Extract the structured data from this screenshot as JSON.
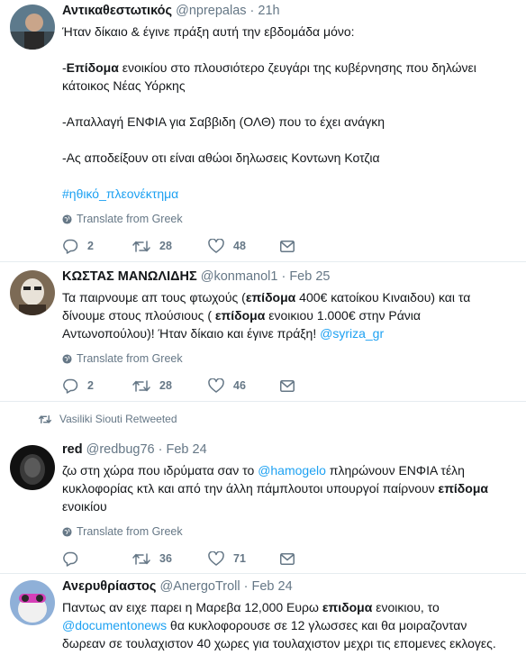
{
  "tweets": [
    {
      "name": "Αντικαθεστωτικός",
      "handle": "@nprepalas",
      "time": "21h",
      "lines": [
        [
          {
            "t": "Ήταν δίκαιο & έγινε πράξη αυτή την εβδομάδα μόνο:"
          }
        ],
        [],
        [
          {
            "t": "-"
          },
          {
            "t": "Επίδομα",
            "b": true
          },
          {
            "t": " ενοικίου στο πλουσιότερο ζευγάρι της κυβέρνησης που δηλώνει"
          }
        ],
        [
          {
            "t": "κάτοικος Νέας Υόρκης"
          }
        ],
        [],
        [
          {
            "t": "-Απαλλαγή ΕΝΦΙΑ για Σαββιδη (ΟΛΘ) που το έχει ανάγκη"
          }
        ],
        [],
        [
          {
            "t": "-Ας αποδείξουν οτι είναι αθώοι δηλωσεις Κοντωνη Κοτζια"
          }
        ],
        [],
        [
          {
            "t": "#ηθικό_πλεονέκτημα",
            "l": true
          }
        ]
      ],
      "translate": "Translate from Greek",
      "replies": "2",
      "retweets": "28",
      "likes": "48"
    },
    {
      "name": "ΚΩΣΤΑΣ ΜΑΝΩΛΙΔΗΣ",
      "handle": "@konmanol1",
      "time": "Feb 25",
      "lines": [
        [
          {
            "t": "Τα παιρνουμε απ τους φτωχούς ("
          },
          {
            "t": "επίδομα",
            "b": true
          },
          {
            "t": " 400€ κατοίκου Κιναιδου) και τα"
          }
        ],
        [
          {
            "t": "δίνουμε στους πλούσιους ( "
          },
          {
            "t": "επίδομα",
            "b": true
          },
          {
            "t": " ενοικιου 1.000€ στην Ράνια"
          }
        ],
        [
          {
            "t": "Αντωνοπούλου)! Ήταν δίκαιο και έγινε πράξη! "
          },
          {
            "t": "@syriza_gr",
            "l": true
          }
        ]
      ],
      "translate": "Translate from Greek",
      "replies": "2",
      "retweets": "28",
      "likes": "46"
    },
    {
      "retweeted_by": "Vasiliki Siouti Retweeted",
      "name": "red",
      "handle": "@redbug76",
      "time": "Feb 24",
      "lines": [
        [
          {
            "t": "ζω στη χώρα που ιδρύματα σαν το "
          },
          {
            "t": "@hamogelo",
            "l": true
          },
          {
            "t": " πληρώνουν ΕΝΦΙΑ τέλη"
          }
        ],
        [
          {
            "t": "κυκλοφορίας κτλ και από την άλλη πάμπλουτοι υπουργοί παίρνουν "
          },
          {
            "t": "επίδομα",
            "b": true
          }
        ],
        [
          {
            "t": "ενοικίου"
          }
        ]
      ],
      "translate": "Translate from Greek",
      "replies": "",
      "retweets": "36",
      "likes": "71"
    },
    {
      "name": "Ανερυθρίαστος",
      "handle": "@AnergoTroll",
      "time": "Feb 24",
      "lines": [
        [
          {
            "t": "Παντως αν ειχε παρει η Μαρεβα 12,000 Ευρω "
          },
          {
            "t": "επιδομα",
            "b": true
          },
          {
            "t": " ενοικιου, το"
          }
        ],
        [
          {
            "t": "@documentonews",
            "l": true
          },
          {
            "t": " θα κυκλοφορουσε σε 12 γλωσσες και θα μοιραζονταν"
          }
        ],
        [
          {
            "t": "δωρεαν σε τουλαχιστον 40 χωρες για τουλαχιστον μεχρι τις επομενες εκλογες."
          }
        ]
      ],
      "translate": "",
      "replies": "",
      "retweets": "",
      "likes": ""
    }
  ],
  "colors": {
    "link": "#1da1f2",
    "muted": "#657786",
    "text": "#14171a",
    "border": "#e6ecf0"
  },
  "icons": [
    "reply-icon",
    "retweet-icon",
    "like-icon",
    "message-icon",
    "globe-icon"
  ]
}
